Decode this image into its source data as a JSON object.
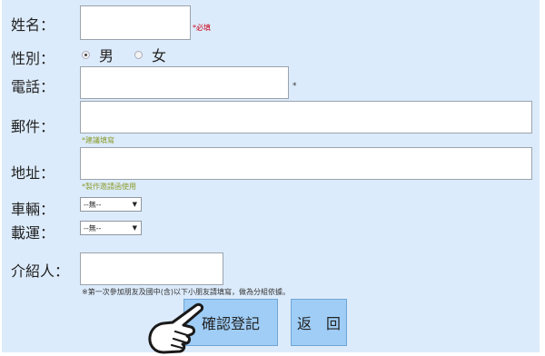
{
  "fields": {
    "name_label": "姓名：",
    "name_required": "*必填",
    "gender_label": "性別：",
    "gender_male": "男",
    "gender_female": "女",
    "phone_label": "電話：",
    "phone_star": "*",
    "email_label": "郵件：",
    "email_hint": "*建議填寫",
    "address_label": "地址：",
    "address_hint": "*製作邀請函使用",
    "vehicle_label": "車輛：",
    "vehicle_value": "--無--",
    "shuttle_label": "載運：",
    "shuttle_value": "--無--",
    "referrer_label": "介紹人：",
    "referrer_hint": "※第一次參加朋友及國中(含)以下小朋友請填寫，做為分組依據。"
  },
  "buttons": {
    "confirm": "確認登記",
    "back": "返　回"
  },
  "colors": {
    "form_background": "#dcebfb",
    "button_background": "#9fcdf6",
    "required_red": "#d0021b",
    "hint_olive": "#8a9b2a"
  },
  "icons": {
    "pointer": "pointing-hand-icon"
  }
}
